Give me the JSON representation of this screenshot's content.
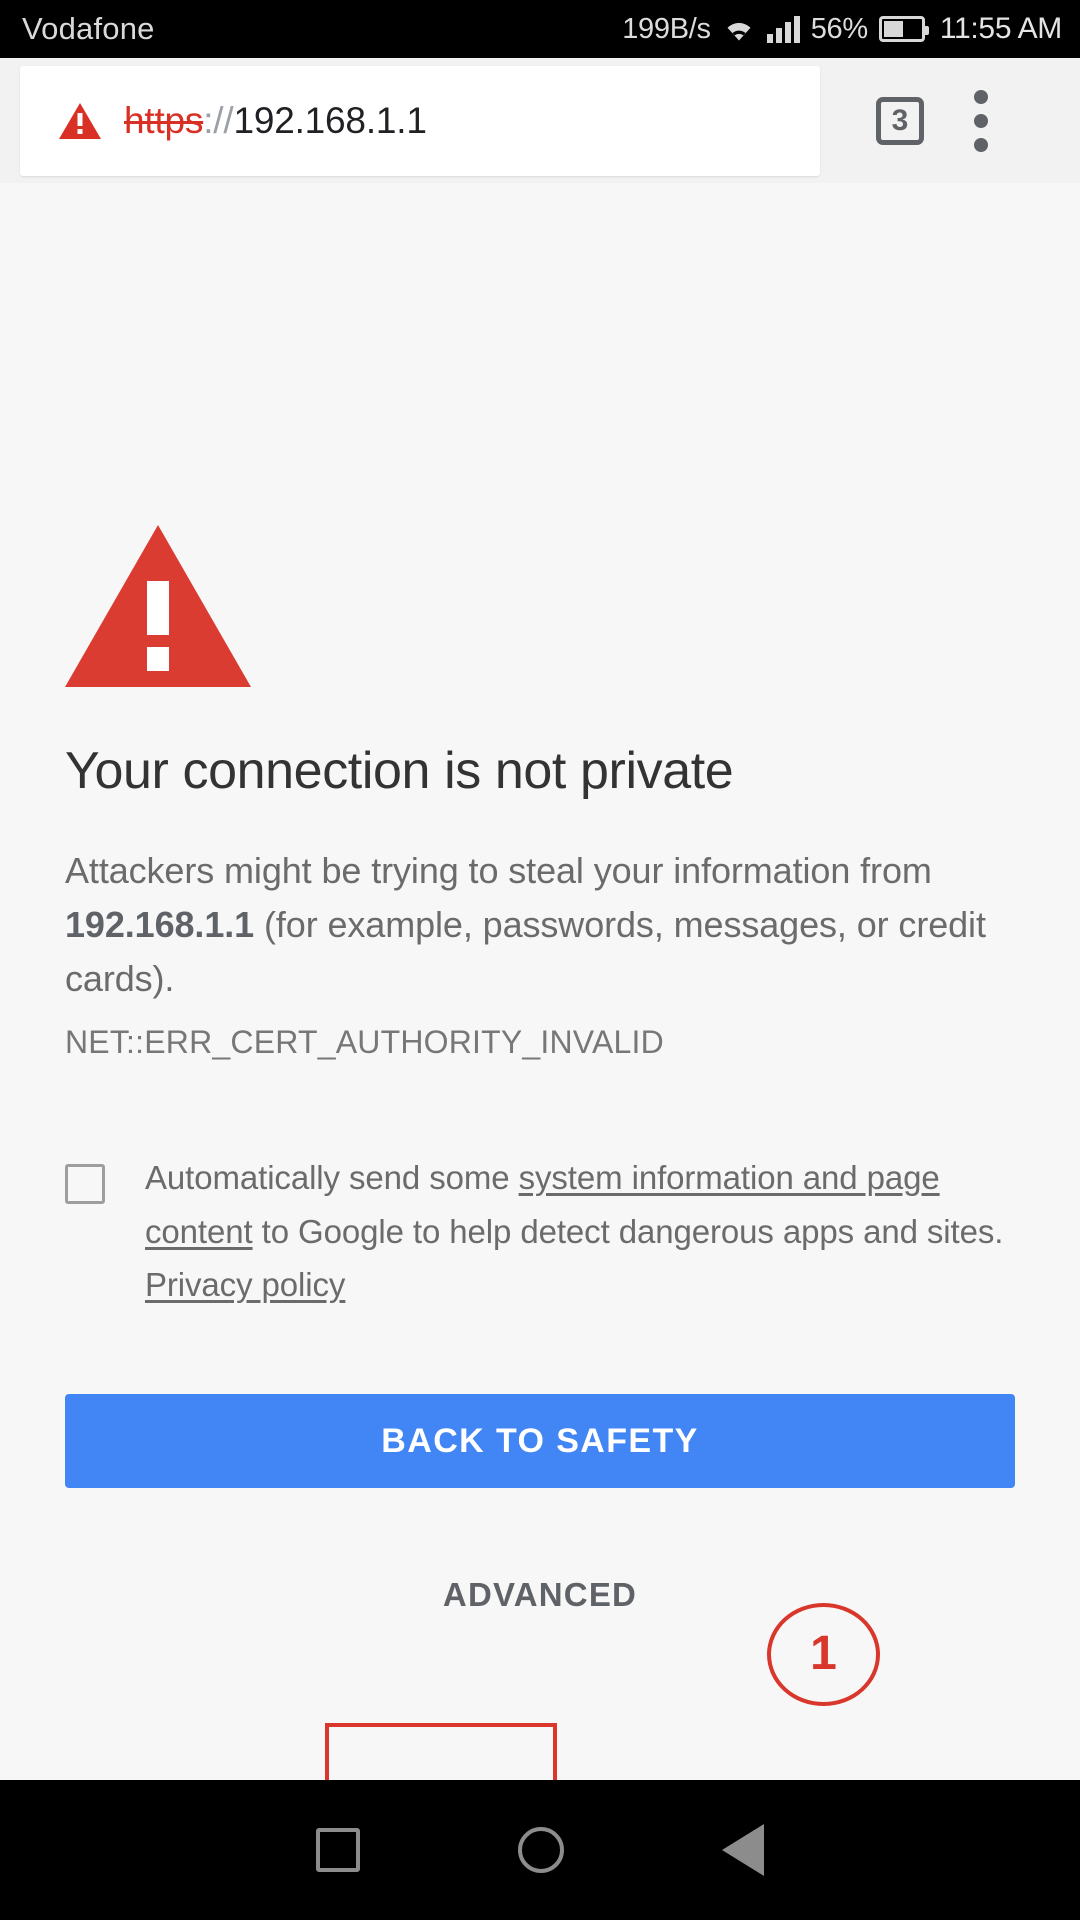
{
  "status_bar": {
    "carrier": "Vodafone",
    "net_speed": "199B/s",
    "battery_percent": "56%",
    "time": "11:55 AM",
    "wifi_icon": "wifi-icon",
    "signal_icon": "cellular-signal-icon",
    "battery_icon": "battery-icon"
  },
  "toolbar": {
    "url_scheme": "https",
    "url_separator": "://",
    "url_host": "192.168.1.1",
    "security_icon": "warning-triangle-icon",
    "tab_count": "3",
    "menu_icon": "overflow-menu-icon"
  },
  "interstitial": {
    "hero_icon": "warning-triangle-icon",
    "title": "Your connection is not private",
    "body_prefix": "Attackers might be trying to steal your information from ",
    "body_host": "192.168.1.1",
    "body_suffix": " (for example, passwords, messages, or credit cards).",
    "error_code": "NET::ERR_CERT_AUTHORITY_INVALID",
    "optin": {
      "checked": false,
      "text_part1": "Automatically send some ",
      "link1": "system information and page content",
      "text_part2": " to Google to help detect dangerous apps and sites. ",
      "link2": "Privacy policy"
    },
    "back_to_safety_label": "BACK TO SAFETY",
    "advanced_label": "ADVANCED"
  },
  "annotations": {
    "step_number": "1",
    "accent_color": "#d9372c"
  },
  "navbar": {
    "recents_icon": "recents-square-icon",
    "home_icon": "home-circle-icon",
    "back_icon": "back-triangle-icon"
  },
  "colors": {
    "warning_red": "#d93025",
    "primary_blue": "#4285f4",
    "page_bg": "#f7f7f7",
    "toolbar_bg": "#f2f2f2"
  }
}
